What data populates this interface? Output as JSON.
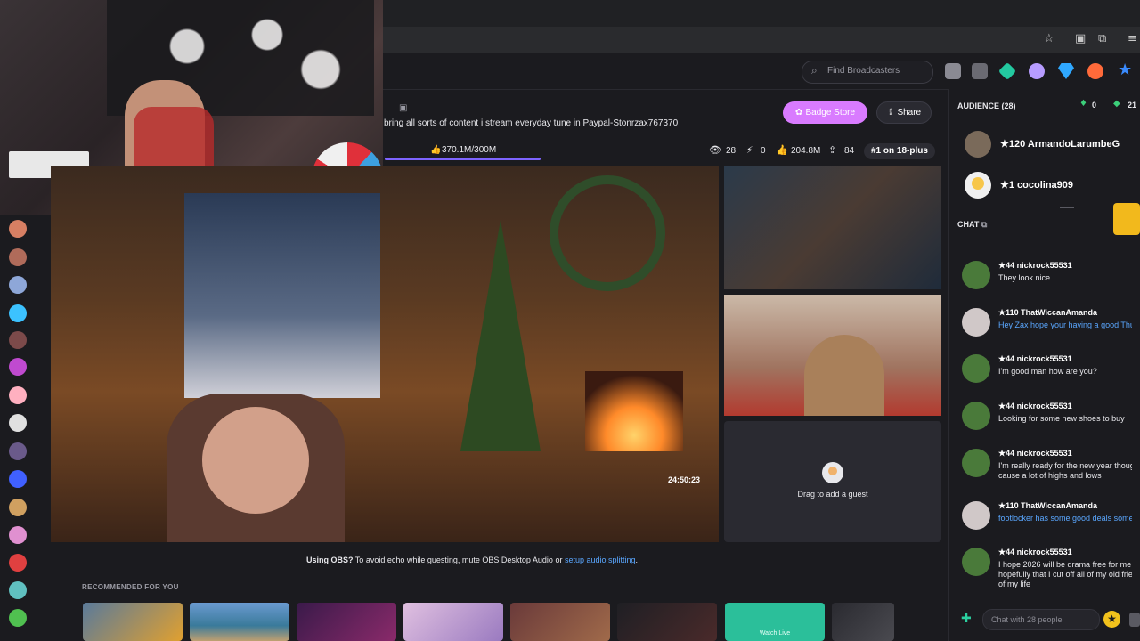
{
  "nav": {
    "search_placeholder": "Find Broadcasters"
  },
  "stream": {
    "description": "bring all sorts of content i stream everyday tune in Paypal-Stonrzax767370",
    "progress_text": "370.1M/300M",
    "progress_fraction": 1.0,
    "viewers": "28",
    "bolts": "0",
    "likes": "204.8M",
    "shares": "84",
    "rank": "#1 on 18-plus",
    "badge_store_label": "Badge Store",
    "share_label": "Share",
    "timestamp": "24:50:23"
  },
  "guest": {
    "drag_label": "Drag to add a guest"
  },
  "obs_note": {
    "prefix": "Using OBS?",
    "body": " To avoid echo while guesting, mute OBS Desktop Audio or ",
    "link": "setup audio splitting",
    "suffix": "."
  },
  "recommended": {
    "heading": "RECOMMENDED FOR YOU",
    "live_label": "Watch Live"
  },
  "audience": {
    "heading": "AUDIENCE (28)",
    "count_a": "0",
    "count_b": "21",
    "members": [
      {
        "name": "★120  ArmandoLarumbeG"
      },
      {
        "name": "★1  cocolina909"
      }
    ]
  },
  "chat": {
    "heading": "CHAT",
    "placeholder": "Chat with 28 people",
    "messages": [
      {
        "user": "★44  nickrock55531",
        "text": "They look nice",
        "blue": false
      },
      {
        "user": "★110  ThatWiccanAmanda",
        "text": "Hey Zax hope your having a good Thu",
        "blue": true
      },
      {
        "user": "★44  nickrock55531",
        "text": "I'm good man how are you?",
        "blue": false
      },
      {
        "user": "★44  nickrock55531",
        "text": "Looking for some new shoes to buy",
        "blue": false
      },
      {
        "user": "★44  nickrock55531",
        "text": "I'm really ready for the new year thoug",
        "text2": "cause a lot of highs and lows",
        "blue": false
      },
      {
        "user": "★110  ThatWiccanAmanda",
        "text": "footlocker has some good deals some",
        "blue": true
      },
      {
        "user": "★44  nickrock55531",
        "text": "I hope 2026 will be drama free for me",
        "text2": "hopefully that I cut off all of my old frie",
        "text3": "of my life",
        "blue": false
      }
    ]
  }
}
